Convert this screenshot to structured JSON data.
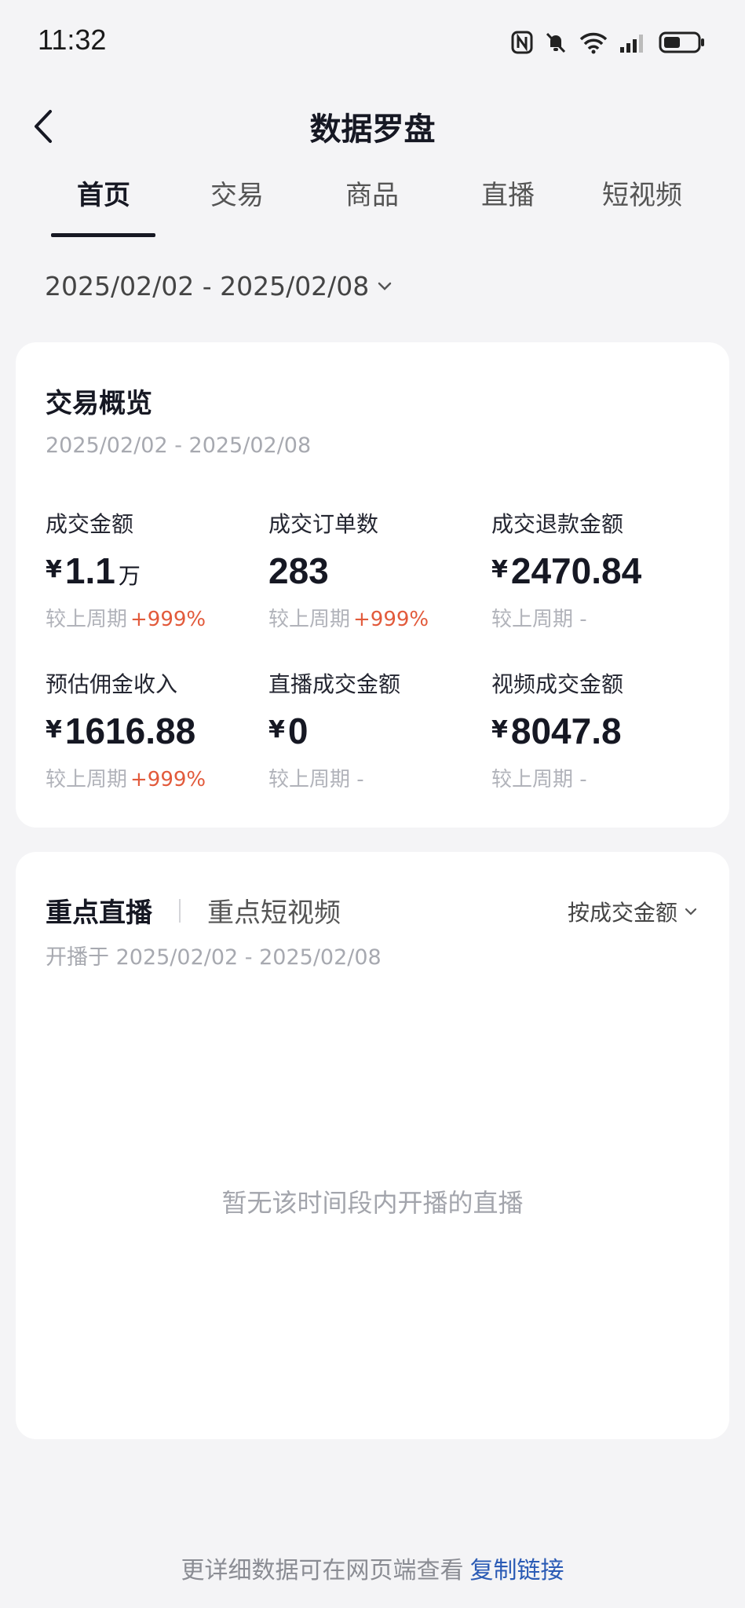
{
  "status_bar": {
    "time": "11:32",
    "icons": [
      "nfc-icon",
      "mute-bell-icon",
      "wifi-icon",
      "signal-icon",
      "battery-icon"
    ]
  },
  "header": {
    "title": "数据罗盘",
    "back_icon": "chevron-left-icon"
  },
  "tabs": [
    {
      "label": "首页",
      "active": true
    },
    {
      "label": "交易",
      "active": false
    },
    {
      "label": "商品",
      "active": false
    },
    {
      "label": "直播",
      "active": false
    },
    {
      "label": "短视频",
      "active": false
    }
  ],
  "date_range": {
    "label": "2025/02/02 - 2025/02/08",
    "icon": "chevron-down-icon"
  },
  "overview": {
    "title": "交易概览",
    "date": "2025/02/02 - 2025/02/08",
    "metrics": [
      {
        "label": "成交金额",
        "currency": "¥",
        "value": "1.1",
        "unit": "万",
        "compare": "较上周期",
        "delta": "+999%"
      },
      {
        "label": "成交订单数",
        "currency": "",
        "value": "283",
        "unit": "",
        "compare": "较上周期",
        "delta": "+999%"
      },
      {
        "label": "成交退款金额",
        "currency": "¥",
        "value": "2470.84",
        "unit": "",
        "compare": "较上周期 -",
        "delta": ""
      },
      {
        "label": "预估佣金收入",
        "currency": "¥",
        "value": "1616.88",
        "unit": "",
        "compare": "较上周期",
        "delta": "+999%"
      },
      {
        "label": "直播成交金额",
        "currency": "¥",
        "value": "0",
        "unit": "",
        "compare": "较上周期 -",
        "delta": ""
      },
      {
        "label": "视频成交金额",
        "currency": "¥",
        "value": "8047.8",
        "unit": "",
        "compare": "较上周期 -",
        "delta": ""
      }
    ]
  },
  "key_section": {
    "tabs": [
      {
        "label": "重点直播",
        "active": true
      },
      {
        "label": "重点短视频",
        "active": false
      }
    ],
    "sort_label": "按成交金额",
    "range": "开播于 2025/02/02 - 2025/02/08",
    "empty_text": "暂无该时间段内开播的直播"
  },
  "footer": {
    "text": "更详细数据可在网页端查看",
    "link": "复制链接"
  },
  "colors": {
    "accent_up": "#e25a3b",
    "link": "#2b5bb5",
    "background": "#f4f4f6"
  }
}
